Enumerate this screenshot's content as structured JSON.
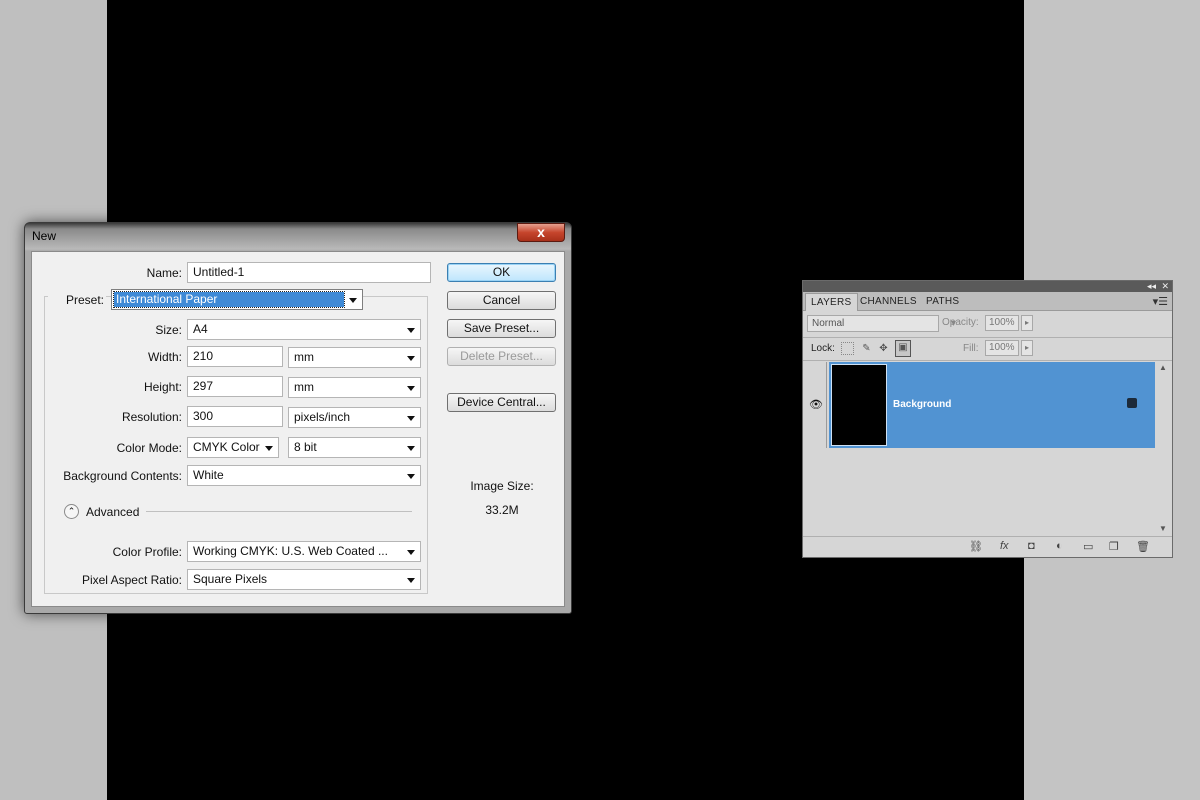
{
  "dialog": {
    "title": "New",
    "close_label": "x",
    "name_label": "Name:",
    "name_value": "Untitled-1",
    "preset_label": "Preset:",
    "preset_value": "International Paper",
    "size_label": "Size:",
    "size_value": "A4",
    "width_label": "Width:",
    "width_value": "210",
    "width_unit": "mm",
    "height_label": "Height:",
    "height_value": "297",
    "height_unit": "mm",
    "resolution_label": "Resolution:",
    "resolution_value": "300",
    "resolution_unit": "pixels/inch",
    "color_mode_label": "Color Mode:",
    "color_mode_value": "CMYK Color",
    "bit_depth_value": "8 bit",
    "background_label": "Background Contents:",
    "background_value": "White",
    "advanced_label": "Advanced",
    "advanced_icon": "chevron-up-icon",
    "color_profile_label": "Color Profile:",
    "color_profile_value": "Working CMYK:  U.S. Web Coated ...",
    "pixel_aspect_label": "Pixel Aspect Ratio:",
    "pixel_aspect_value": "Square Pixels",
    "buttons": {
      "ok": "OK",
      "cancel": "Cancel",
      "save_preset": "Save Preset...",
      "delete_preset": "Delete Preset...",
      "device_central": "Device Central..."
    },
    "image_size_label": "Image Size:",
    "image_size_value": "33.2M"
  },
  "layers_panel": {
    "tabs": [
      "LAYERS",
      "CHANNELS",
      "PATHS"
    ],
    "blend_mode": "Normal",
    "opacity_label": "Opacity:",
    "opacity_value": "100%",
    "lock_label": "Lock:",
    "fill_label": "Fill:",
    "fill_value": "100%",
    "layer_name": "Background",
    "collapse_label": "◂◂",
    "close_label": "✕",
    "menu_label": "▾☰"
  },
  "colors": {
    "selection": "#5193d2",
    "canvas": "#000000",
    "workspace": "#bfbfbf"
  }
}
